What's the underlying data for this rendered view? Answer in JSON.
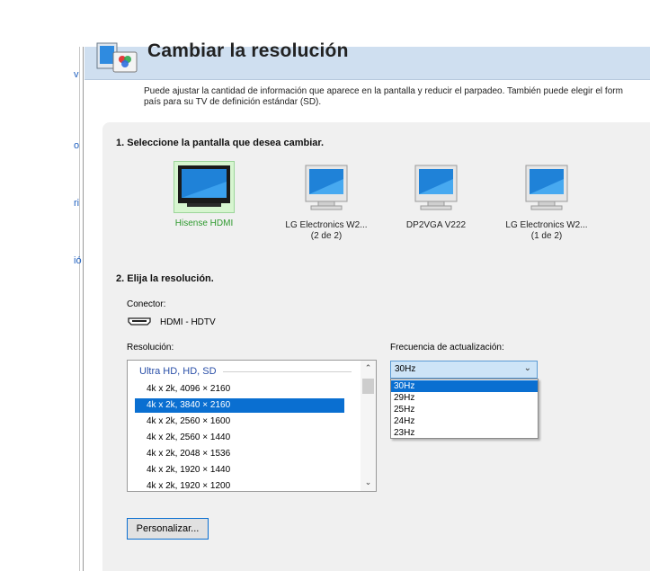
{
  "left_nav": {
    "items": [
      "v",
      "o",
      "ri",
      "ió"
    ]
  },
  "header": {
    "title": "Cambiar la resolución"
  },
  "description": {
    "line1": "Puede ajustar la cantidad de información que aparece en la pantalla y reducir el parpadeo. También puede elegir el form",
    "line2": "país para su TV de definición estándar (SD)."
  },
  "step1": {
    "label": "1. Seleccione la pantalla que desea cambiar."
  },
  "monitors": [
    {
      "line1": "Hisense HDMI",
      "line2": ""
    },
    {
      "line1": "LG Electronics W2...",
      "line2": "(2 de 2)"
    },
    {
      "line1": "DP2VGA V222",
      "line2": ""
    },
    {
      "line1": "LG Electronics W2...",
      "line2": "(1 de 2)"
    }
  ],
  "step2": {
    "label": "2. Elija la resolución."
  },
  "connector": {
    "label": "Conector:",
    "value": "HDMI - HDTV",
    "icon": "hdmi-connector-icon"
  },
  "resolution": {
    "label": "Resolución:",
    "group": "Ultra HD, HD, SD",
    "items": [
      "4k x 2k, 4096 × 2160",
      "4k x 2k, 3840 × 2160",
      "4k x 2k, 2560 × 1600",
      "4k x 2k, 2560 × 1440",
      "4k x 2k, 2048 × 1536",
      "4k x 2k, 1920 × 1440",
      "4k x 2k, 1920 × 1200"
    ],
    "selected": "4k x 2k, 3840 × 2160"
  },
  "refresh": {
    "label": "Frecuencia de actualización:",
    "value": "30Hz",
    "options": [
      "30Hz",
      "29Hz",
      "25Hz",
      "24Hz",
      "23Hz"
    ]
  },
  "customize_button": "Personalizar...",
  "colors": {
    "accent": "#0a6fd1",
    "header_bg": "#cfdff0",
    "selected_monitor_text": "#2e9a2e",
    "panel_bg": "#f0f0f0"
  }
}
